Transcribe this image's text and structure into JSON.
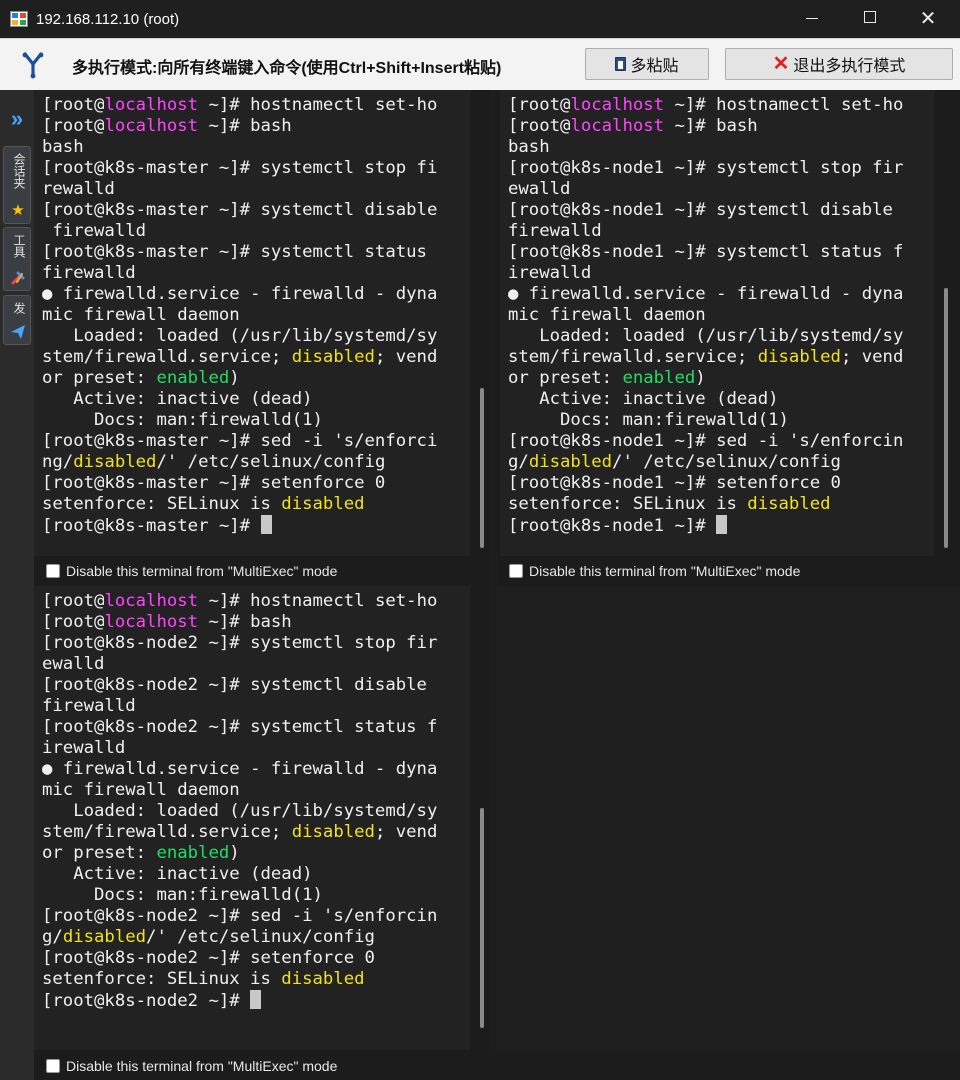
{
  "window": {
    "title": "192.168.112.10 (root)",
    "minimize": "—",
    "maximize": "□",
    "close": "✕"
  },
  "toolbar": {
    "mode_label": "多执行模式:向所有终端键入命令(使用Ctrl+Shift+Insert粘贴)",
    "multi_paste_label": "多粘贴",
    "exit_label": "退出多执行模式"
  },
  "sidebar": {
    "expand_icon": "»",
    "tabs": [
      {
        "label": "会话夹",
        "icon": "star-icon"
      },
      {
        "label": "工具",
        "icon": "tools-icon"
      },
      {
        "label": "发",
        "icon": "send-icon"
      }
    ]
  },
  "multiexec_checkbox_label": "Disable this terminal from \"MultiExec\" mode",
  "terminals": [
    {
      "name": "k8s-master",
      "lines": [
        [
          {
            "t": "[root@"
          },
          {
            "t": "localhost",
            "c": "mag"
          },
          {
            "t": " ~]# hostnamectl set-ho"
          }
        ],
        [
          {
            "t": "[root@"
          },
          {
            "t": "localhost",
            "c": "mag"
          },
          {
            "t": " ~]# bash"
          }
        ],
        [
          {
            "t": "bash"
          }
        ],
        [
          {
            "t": "[root@k8s-master ~]# systemctl stop fi"
          }
        ],
        [
          {
            "t": "rewalld"
          }
        ],
        [
          {
            "t": "[root@k8s-master ~]# systemctl disable"
          }
        ],
        [
          {
            "t": " firewalld"
          }
        ],
        [
          {
            "t": "[root@k8s-master ~]# systemctl status "
          }
        ],
        [
          {
            "t": "firewalld"
          }
        ],
        [
          {
            "t": "● firewalld.service - firewalld - dyna"
          }
        ],
        [
          {
            "t": "mic firewall daemon"
          }
        ],
        [
          {
            "t": "   Loaded: loaded (/usr/lib/systemd/sy"
          }
        ],
        [
          {
            "t": "stem/firewalld.service; "
          },
          {
            "t": "disabled",
            "c": "yel"
          },
          {
            "t": "; vend"
          }
        ],
        [
          {
            "t": "or preset: "
          },
          {
            "t": "enabled",
            "c": "grn"
          },
          {
            "t": ")"
          }
        ],
        [
          {
            "t": "   Active: inactive (dead)"
          }
        ],
        [
          {
            "t": "     Docs: man:firewalld(1)"
          }
        ],
        [
          {
            "t": "[root@k8s-master ~]# sed -i 's/enforci"
          }
        ],
        [
          {
            "t": "ng/"
          },
          {
            "t": "disabled",
            "c": "yel"
          },
          {
            "t": "/' /etc/selinux/config"
          }
        ],
        [
          {
            "t": "[root@k8s-master ~]# setenforce 0"
          }
        ],
        [
          {
            "t": "setenforce: SELinux is "
          },
          {
            "t": "disabled",
            "c": "yel"
          }
        ],
        [
          {
            "t": "[root@k8s-master ~]# "
          },
          {
            "cursor": true
          }
        ]
      ]
    },
    {
      "name": "k8s-node1",
      "lines": [
        [
          {
            "t": "[root@"
          },
          {
            "t": "localhost",
            "c": "mag"
          },
          {
            "t": " ~]# hostnamectl set-ho"
          }
        ],
        [
          {
            "t": "[root@"
          },
          {
            "t": "localhost",
            "c": "mag"
          },
          {
            "t": " ~]# bash"
          }
        ],
        [
          {
            "t": "bash"
          }
        ],
        [
          {
            "t": "[root@k8s-node1 ~]# systemctl stop fir"
          }
        ],
        [
          {
            "t": "ewalld"
          }
        ],
        [
          {
            "t": "[root@k8s-node1 ~]# systemctl disable "
          }
        ],
        [
          {
            "t": "firewalld"
          }
        ],
        [
          {
            "t": "[root@k8s-node1 ~]# systemctl status f"
          }
        ],
        [
          {
            "t": "irewalld"
          }
        ],
        [
          {
            "t": "● firewalld.service - firewalld - dyna"
          }
        ],
        [
          {
            "t": "mic firewall daemon"
          }
        ],
        [
          {
            "t": "   Loaded: loaded (/usr/lib/systemd/sy"
          }
        ],
        [
          {
            "t": "stem/firewalld.service; "
          },
          {
            "t": "disabled",
            "c": "yel"
          },
          {
            "t": "; vend"
          }
        ],
        [
          {
            "t": "or preset: "
          },
          {
            "t": "enabled",
            "c": "grn"
          },
          {
            "t": ")"
          }
        ],
        [
          {
            "t": "   Active: inactive (dead)"
          }
        ],
        [
          {
            "t": "     Docs: man:firewalld(1)"
          }
        ],
        [
          {
            "t": "[root@k8s-node1 ~]# sed -i 's/enforcin"
          }
        ],
        [
          {
            "t": "g/"
          },
          {
            "t": "disabled",
            "c": "yel"
          },
          {
            "t": "/' /etc/selinux/config"
          }
        ],
        [
          {
            "t": "[root@k8s-node1 ~]# setenforce 0"
          }
        ],
        [
          {
            "t": "setenforce: SELinux is "
          },
          {
            "t": "disabled",
            "c": "yel"
          }
        ],
        [
          {
            "t": "[root@k8s-node1 ~]# "
          },
          {
            "cursor": true
          }
        ]
      ]
    },
    {
      "name": "k8s-node2",
      "lines": [
        [
          {
            "t": "[root@"
          },
          {
            "t": "localhost",
            "c": "mag"
          },
          {
            "t": " ~]# hostnamectl set-ho"
          }
        ],
        [
          {
            "t": "[root@"
          },
          {
            "t": "localhost",
            "c": "mag"
          },
          {
            "t": " ~]# bash"
          }
        ],
        [
          {
            "t": "[root@k8s-node2 ~]# systemctl stop fir"
          }
        ],
        [
          {
            "t": "ewalld"
          }
        ],
        [
          {
            "t": "[root@k8s-node2 ~]# systemctl disable "
          }
        ],
        [
          {
            "t": "firewalld"
          }
        ],
        [
          {
            "t": "[root@k8s-node2 ~]# systemctl status f"
          }
        ],
        [
          {
            "t": "irewalld"
          }
        ],
        [
          {
            "t": "● firewalld.service - firewalld - dyna"
          }
        ],
        [
          {
            "t": "mic firewall daemon"
          }
        ],
        [
          {
            "t": "   Loaded: loaded (/usr/lib/systemd/sy"
          }
        ],
        [
          {
            "t": "stem/firewalld.service; "
          },
          {
            "t": "disabled",
            "c": "yel"
          },
          {
            "t": "; vend"
          }
        ],
        [
          {
            "t": "or preset: "
          },
          {
            "t": "enabled",
            "c": "grn"
          },
          {
            "t": ")"
          }
        ],
        [
          {
            "t": "   Active: inactive (dead)"
          }
        ],
        [
          {
            "t": "     Docs: man:firewalld(1)"
          }
        ],
        [
          {
            "t": "[root@k8s-node2 ~]# sed -i 's/enforcin"
          }
        ],
        [
          {
            "t": "g/"
          },
          {
            "t": "disabled",
            "c": "yel"
          },
          {
            "t": "/' /etc/selinux/config"
          }
        ],
        [
          {
            "t": "[root@k8s-node2 ~]# setenforce 0"
          }
        ],
        [
          {
            "t": "setenforce: SELinux is "
          },
          {
            "t": "disabled",
            "c": "yel"
          }
        ],
        [
          {
            "t": "[root@k8s-node2 ~]# "
          },
          {
            "cursor": true
          }
        ]
      ]
    }
  ],
  "colors": {
    "magenta": "#ff44ff",
    "yellow": "#f2e21a",
    "green": "#22dd66",
    "accent_blue": "#4aa3ff"
  }
}
